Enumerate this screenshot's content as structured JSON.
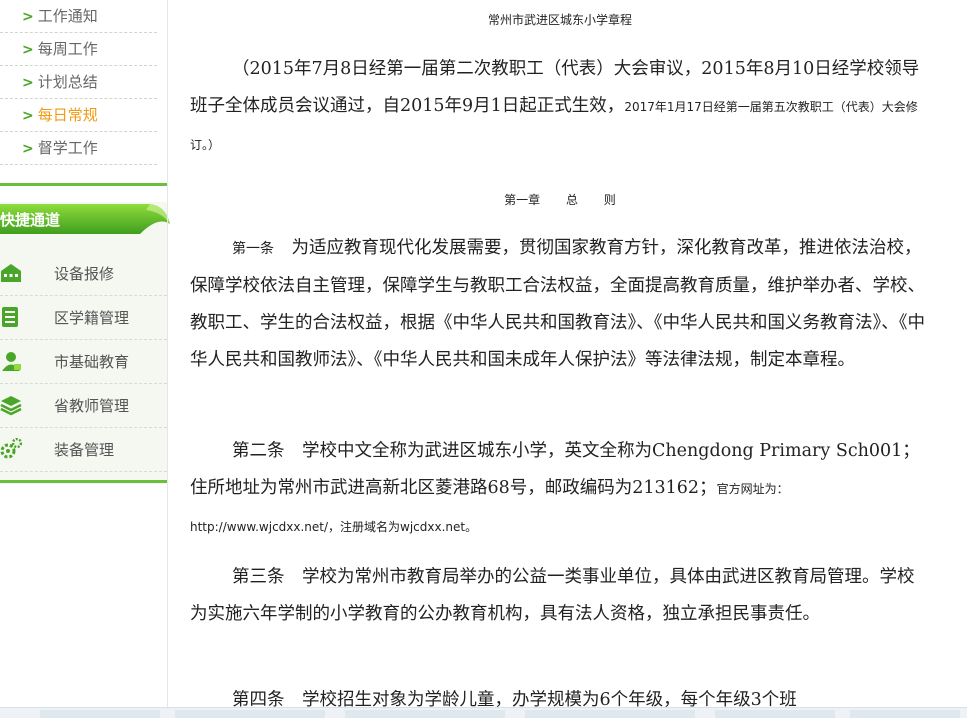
{
  "sidebar": {
    "nav_items": [
      {
        "label": "工作通知",
        "active": false
      },
      {
        "label": "每周工作",
        "active": false
      },
      {
        "label": "计划总结",
        "active": false
      },
      {
        "label": "每日常规",
        "active": true
      },
      {
        "label": "督学工作",
        "active": false
      }
    ],
    "arrow_glyph": ">",
    "quick_title": "快捷通道",
    "quick_items": [
      {
        "label": "设备报修",
        "icon": "building-icon"
      },
      {
        "label": "区学籍管理",
        "icon": "document-list-icon"
      },
      {
        "label": "市基础教育",
        "icon": "teacher-icon"
      },
      {
        "label": "省教师管理",
        "icon": "layers-icon"
      },
      {
        "label": "装备管理",
        "icon": "gears-icon"
      }
    ],
    "colors": {
      "accent_green": "#6cbf3a",
      "active_orange": "#f39a12"
    }
  },
  "document": {
    "title": "常州市武进区城东小学章程",
    "intro_main": "（2015年7月8日经第一届第二次教职工（代表）大会审议，2015年8月10日经学校领导班子全体成员会议通过，自2015年9月1日起正式生效，",
    "intro_small": "2017年1月17日经第一届第五次教职工（代表）大会修订。）",
    "chapter_heading": "第一章 总 则",
    "article1_label": "第一条",
    "article1_text": "为适应教育现代化发展需要，贯彻国家教育方针，深化教育改革，推进依法治校，保障学校依法自主管理，保障学生与教职工合法权益，全面提高教育质量，维护举办者、学校、教职工、学生的合法权益，根据《中华人民共和国教育法》、《中华人民共和国义务教育法》、《中华人民共和国教师法》、《中华人民共和国未成年人保护法》等法律法规，制定本章程。",
    "article2_main": "第二条　学校中文全称为武进区城东小学，英文全称为Chengdong Primary Sch001；住所地址为常州市武进高新北区菱港路68号，邮政编码为213162；",
    "article2_small": "官方网址为：http://www.wjcdxx.net/，注册域名为wjcdxx.net。",
    "article3": "第三条　学校为常州市教育局举办的公益一类事业单位，具体由武进区教育局管理。学校为实施六年学制的小学教育的公办教育机构，具有法人资格，独立承担民事责任。",
    "article4": "第四条　学校招生对象为学龄儿童，办学规模为6个年级，每个年级3个班"
  }
}
